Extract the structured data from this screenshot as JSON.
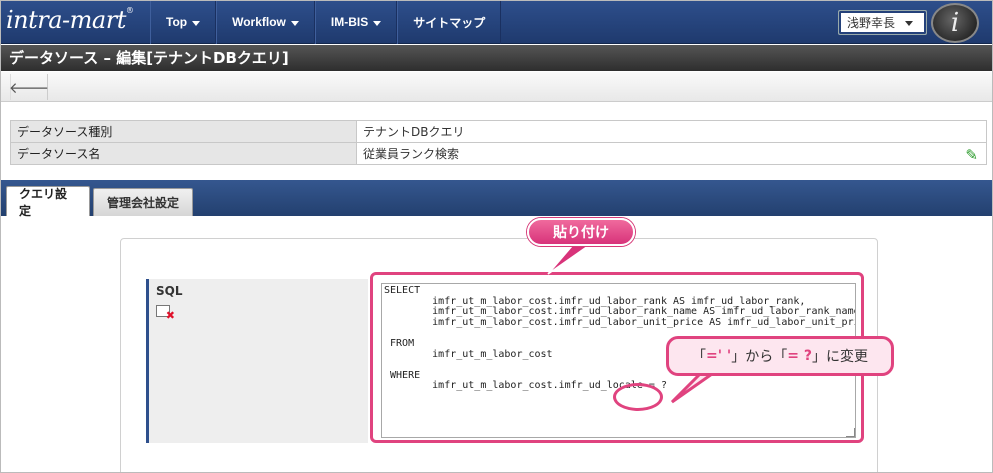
{
  "header": {
    "logo": "intra-mart",
    "logo_mark": "®",
    "nav": [
      "Top",
      "Workflow",
      "IM-BIS",
      "サイトマップ"
    ],
    "user_name": "浅野幸長",
    "user_icon": "i"
  },
  "page_title": "データソース – 編集[テナントDBクエリ]",
  "toolbar": {
    "back_icon": "arrow-left-icon"
  },
  "info": [
    {
      "label": "データソース種別",
      "value": "テナントDBクエリ"
    },
    {
      "label": "データソース名",
      "value": "従業員ランク検索"
    }
  ],
  "tabs": [
    "クエリ設定",
    "管理会社設定"
  ],
  "sql": {
    "label": "SQL",
    "text": "SELECT\n        imfr_ut_m_labor_cost.imfr_ud_labor_rank AS imfr_ud_labor_rank,\n        imfr_ut_m_labor_cost.imfr_ud_labor_rank_name AS imfr_ud_labor_rank_name,\n        imfr_ut_m_labor_cost.imfr_ud_labor_unit_price AS imfr_ud_labor_unit_price\n\n FROM\n        imfr_ut_m_labor_cost\n\n WHERE\n        imfr_ut_m_labor_cost.imfr_ud_locale = ?"
  },
  "annotations": {
    "paste": "貼り付け",
    "change_prefix": "「",
    "change_from": "=' '",
    "change_mid": "」から「",
    "change_to": "= ?",
    "change_suffix": "」に変更"
  },
  "colors": {
    "nav": "#2e4f8c",
    "accent": "#e0437f"
  }
}
